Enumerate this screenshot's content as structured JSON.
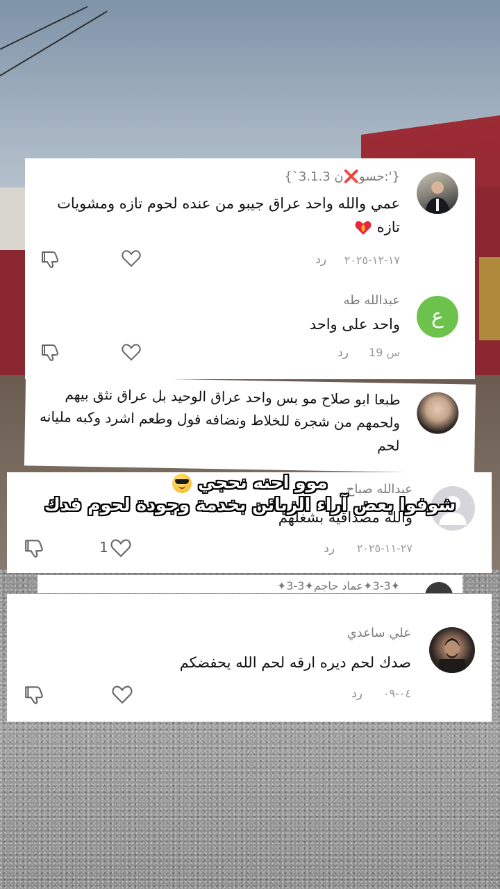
{
  "overlay": {
    "line1": "موو احنه نحجي",
    "line2": "شوفوا بعض آراء الزبائن بخدمة وجودة لحوم فدك",
    "emoji": "smiling-face-with-sunglasses-icon"
  },
  "comments": [
    {
      "author": "{':حسو❌ن 3.1.3`}",
      "text": "عمي والله واحد عراق جيبو من عنده لحوم تازه ومشويات تازه",
      "emoji": "heart-on-fire-icon",
      "date": "١٧-١٢-٢٠٢٥",
      "reply": "رد",
      "likes": ""
    },
    {
      "author": "عبدالله طه",
      "avatar_letter": "ع",
      "avatar_color": "#6cc24a",
      "text": "واحد على واحد",
      "date": "19 س",
      "reply": "رد",
      "likes": ""
    },
    {
      "author": "",
      "text": "طبعا ابو صلاح مو بس واحد عراق الوحيد بل عراق نثق بيهم ولحمهم من شجرة للخلاط ونضافه فول وطعم اشرد وكبه مليانه لحم",
      "date": "",
      "reply": ""
    },
    {
      "author": "عبدالله صباح",
      "text": "والله مصداقيه بشغلهم",
      "date": "٢٧-١١-٢٠٢٥",
      "reply": "رد",
      "likes": "1"
    },
    {
      "author": "✦3-3✦عماد حاجم✦3-3✦",
      "text": "",
      "date": "",
      "reply": ""
    },
    {
      "author": "علي ساعدي",
      "text": "صدك لحم ديره ارقه لحم الله يحفضكم",
      "date": "٠٤-٠٩",
      "reply": "رد",
      "likes": ""
    }
  ],
  "colors": {
    "card_bg": "#ffffff",
    "secondary_text": "#8a8a8a",
    "avatar_green": "#6cc24a"
  }
}
